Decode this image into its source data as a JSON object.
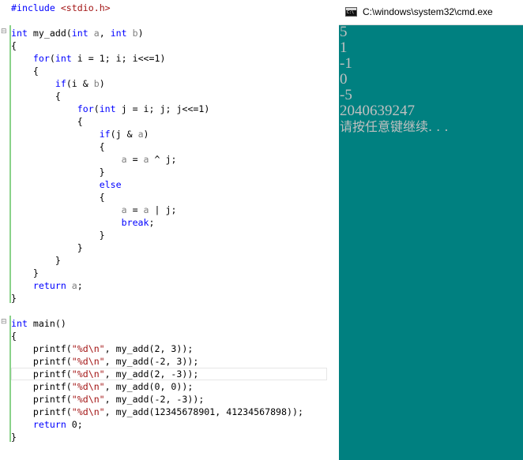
{
  "editor": {
    "lines": [
      [
        {
          "t": "#include ",
          "c": "pp"
        },
        {
          "t": "<stdio.h>",
          "c": "hdr"
        }
      ],
      [],
      [
        {
          "t": "int",
          "c": "kw"
        },
        {
          "t": " my_add(",
          "c": ""
        },
        {
          "t": "int",
          "c": "kw"
        },
        {
          "t": " ",
          "c": ""
        },
        {
          "t": "a",
          "c": "prm"
        },
        {
          "t": ", ",
          "c": ""
        },
        {
          "t": "int",
          "c": "kw"
        },
        {
          "t": " ",
          "c": ""
        },
        {
          "t": "b",
          "c": "prm"
        },
        {
          "t": ")",
          "c": ""
        }
      ],
      [
        {
          "t": "{",
          "c": ""
        }
      ],
      [
        {
          "t": "    ",
          "c": ""
        },
        {
          "t": "for",
          "c": "kw"
        },
        {
          "t": "(",
          "c": ""
        },
        {
          "t": "int",
          "c": "kw"
        },
        {
          "t": " i = 1; i; i<<=1)",
          "c": ""
        }
      ],
      [
        {
          "t": "    {",
          "c": ""
        }
      ],
      [
        {
          "t": "        ",
          "c": ""
        },
        {
          "t": "if",
          "c": "kw"
        },
        {
          "t": "(i & ",
          "c": ""
        },
        {
          "t": "b",
          "c": "prm"
        },
        {
          "t": ")",
          "c": ""
        }
      ],
      [
        {
          "t": "        {",
          "c": ""
        }
      ],
      [
        {
          "t": "            ",
          "c": ""
        },
        {
          "t": "for",
          "c": "kw"
        },
        {
          "t": "(",
          "c": ""
        },
        {
          "t": "int",
          "c": "kw"
        },
        {
          "t": " j = i; j; j<<=1)",
          "c": ""
        }
      ],
      [
        {
          "t": "            {",
          "c": ""
        }
      ],
      [
        {
          "t": "                ",
          "c": ""
        },
        {
          "t": "if",
          "c": "kw"
        },
        {
          "t": "(j & ",
          "c": ""
        },
        {
          "t": "a",
          "c": "prm"
        },
        {
          "t": ")",
          "c": ""
        }
      ],
      [
        {
          "t": "                {",
          "c": ""
        }
      ],
      [
        {
          "t": "                    ",
          "c": ""
        },
        {
          "t": "a",
          "c": "prm"
        },
        {
          "t": " = ",
          "c": ""
        },
        {
          "t": "a",
          "c": "prm"
        },
        {
          "t": " ^ j;",
          "c": ""
        }
      ],
      [
        {
          "t": "                }",
          "c": ""
        }
      ],
      [
        {
          "t": "                ",
          "c": ""
        },
        {
          "t": "else",
          "c": "kw"
        }
      ],
      [
        {
          "t": "                {",
          "c": ""
        }
      ],
      [
        {
          "t": "                    ",
          "c": ""
        },
        {
          "t": "a",
          "c": "prm"
        },
        {
          "t": " = ",
          "c": ""
        },
        {
          "t": "a",
          "c": "prm"
        },
        {
          "t": " | j;",
          "c": ""
        }
      ],
      [
        {
          "t": "                    ",
          "c": ""
        },
        {
          "t": "break",
          "c": "kw"
        },
        {
          "t": ";",
          "c": ""
        }
      ],
      [
        {
          "t": "                }",
          "c": ""
        }
      ],
      [
        {
          "t": "            }",
          "c": ""
        }
      ],
      [
        {
          "t": "        }",
          "c": ""
        }
      ],
      [
        {
          "t": "    }",
          "c": ""
        }
      ],
      [
        {
          "t": "    ",
          "c": ""
        },
        {
          "t": "return",
          "c": "kw"
        },
        {
          "t": " ",
          "c": ""
        },
        {
          "t": "a",
          "c": "prm"
        },
        {
          "t": ";",
          "c": ""
        }
      ],
      [
        {
          "t": "}",
          "c": ""
        }
      ],
      [],
      [
        {
          "t": "int",
          "c": "kw"
        },
        {
          "t": " main()",
          "c": ""
        }
      ],
      [
        {
          "t": "{",
          "c": ""
        }
      ],
      [
        {
          "t": "    printf(",
          "c": ""
        },
        {
          "t": "\"%d\\n\"",
          "c": "str"
        },
        {
          "t": ", my_add(2, 3));",
          "c": ""
        }
      ],
      [
        {
          "t": "    printf(",
          "c": ""
        },
        {
          "t": "\"%d\\n\"",
          "c": "str"
        },
        {
          "t": ", my_add(-2, 3));",
          "c": ""
        }
      ],
      [
        {
          "t": "    printf(",
          "c": ""
        },
        {
          "t": "\"%d\\n\"",
          "c": "str"
        },
        {
          "t": ", my_add(2, -3));",
          "c": ""
        }
      ],
      [
        {
          "t": "    printf(",
          "c": ""
        },
        {
          "t": "\"%d\\n\"",
          "c": "str"
        },
        {
          "t": ", my_add(0, 0));",
          "c": ""
        }
      ],
      [
        {
          "t": "    printf(",
          "c": ""
        },
        {
          "t": "\"%d\\n\"",
          "c": "str"
        },
        {
          "t": ", my_add(-2, -3));",
          "c": ""
        }
      ],
      [
        {
          "t": "    printf(",
          "c": ""
        },
        {
          "t": "\"%d\\n\"",
          "c": "str"
        },
        {
          "t": ", my_add(12345678901, 41234567898));",
          "c": ""
        }
      ],
      [
        {
          "t": "    ",
          "c": ""
        },
        {
          "t": "return",
          "c": "kw"
        },
        {
          "t": " 0;",
          "c": ""
        }
      ],
      [
        {
          "t": "}",
          "c": ""
        }
      ]
    ]
  },
  "console": {
    "title": "C:\\windows\\system32\\cmd.exe",
    "output": [
      "5",
      "1",
      "-1",
      "0",
      "-5",
      "2040639247",
      "请按任意键继续. . ."
    ]
  },
  "colors": {
    "console_bg": "#008080",
    "console_text": "#c0c0c0",
    "keyword": "#0000ff",
    "string": "#a31515",
    "parameter": "#808080"
  }
}
